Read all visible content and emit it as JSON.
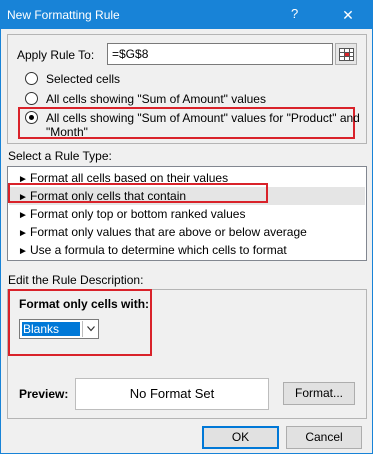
{
  "window": {
    "title": "New Formatting Rule",
    "help_glyph": "?",
    "close_glyph": "✕"
  },
  "apply": {
    "label": "Apply Rule To:",
    "value": "=$G$8"
  },
  "scope_options": [
    {
      "label": "Selected cells",
      "checked": false
    },
    {
      "label": "All cells showing \"Sum of Amount\" values",
      "checked": false
    },
    {
      "label_line1": "All cells showing \"Sum of Amount\" values for \"Product\" and",
      "label_line2": "\"Month\"",
      "checked": true
    }
  ],
  "rule_type": {
    "label": "Select a Rule Type:",
    "items": [
      "Format all cells based on their values",
      "Format only cells that contain",
      "Format only top or bottom ranked values",
      "Format only values that are above or below average",
      "Use a formula to determine which cells to format"
    ],
    "selected_index": 1
  },
  "description": {
    "label": "Edit the Rule Description:",
    "format_label": "Format only cells with:",
    "dropdown_value": "Blanks"
  },
  "preview": {
    "label": "Preview:",
    "text": "No Format Set",
    "format_button": "Format..."
  },
  "buttons": {
    "ok": "OK",
    "cancel": "Cancel"
  },
  "colors": {
    "titlebar": "#1883d7",
    "highlight": "#d9222a",
    "selection": "#0078d7"
  },
  "icons": {
    "collapse": "range-collapse-icon",
    "arrow": "rule-arrow-icon",
    "chevron": "chevron-down-icon"
  }
}
